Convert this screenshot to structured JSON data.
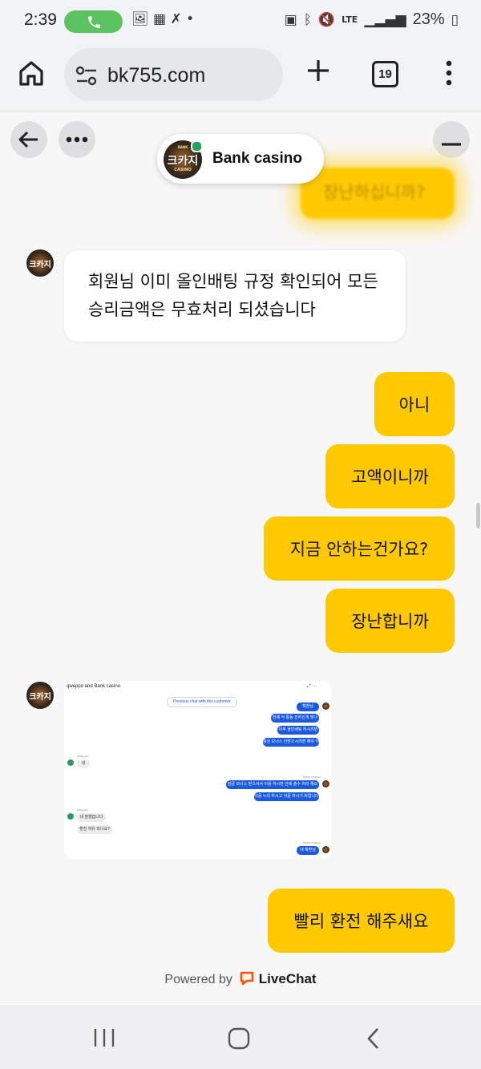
{
  "status_bar": {
    "time": "2:39",
    "lte": "LTE",
    "battery": "23%",
    "icons": [
      "phone-call-icon",
      "image-icon",
      "news-icon",
      "missed-call-icon",
      "bluetooth-icon",
      "mute-icon",
      "signal-icon",
      "battery-icon"
    ]
  },
  "browser": {
    "url": "bk755.com",
    "tab_count": "19",
    "icons": [
      "home-icon",
      "site-settings-icon",
      "new-tab-icon",
      "tabs-icon",
      "more-menu-icon"
    ]
  },
  "chat": {
    "header_title": "Bank casino",
    "logo_text": "크카지",
    "logo_sub_top": "BANK",
    "logo_sub_bottom": "CASINO",
    "faded_message": "장난하십니까?",
    "agent_message": "회원님 이미 올인배팅 규정 확인되어 모든 승리금액은 무효처리 되셨습니다",
    "user_messages": [
      "아니",
      "고액이니까",
      "지금 안하는건가요?",
      "장난합니까"
    ],
    "final_message": "빨리 환전 해주새요",
    "powered_by": "Powered by",
    "powered_brand": "LiveChat",
    "brand_color": "#ffc902",
    "accent_color": "#ff5100"
  },
  "screenshot_attachment": {
    "title": "qweppo and Bank casino",
    "prev_chat": "Previous chat with this customer",
    "agent_label": "Bank casino",
    "customer_label": "qweppo",
    "customer_initial": "q",
    "agent_msgs_1": [
      "확환님",
      "전에 적 활동 진하신게 맞나요",
      "이후 올인배팅 하시려면",
      "잠금 보너스 안받으시려면 해야 이 얘기 나온"
    ],
    "customer_msg_1": "네",
    "agent_msgs_2": [
      "잠금 보너스 받으셔서 이용 하시면 안에 출수 처리 해요 됩니다",
      "이용 누리 하시고 이용 하시기 바랍니다"
    ],
    "customer_msgs_2": [
      "네 말했습니다",
      "환전 여유 되나요?"
    ],
    "agent_msg_3": "네 확환님"
  }
}
